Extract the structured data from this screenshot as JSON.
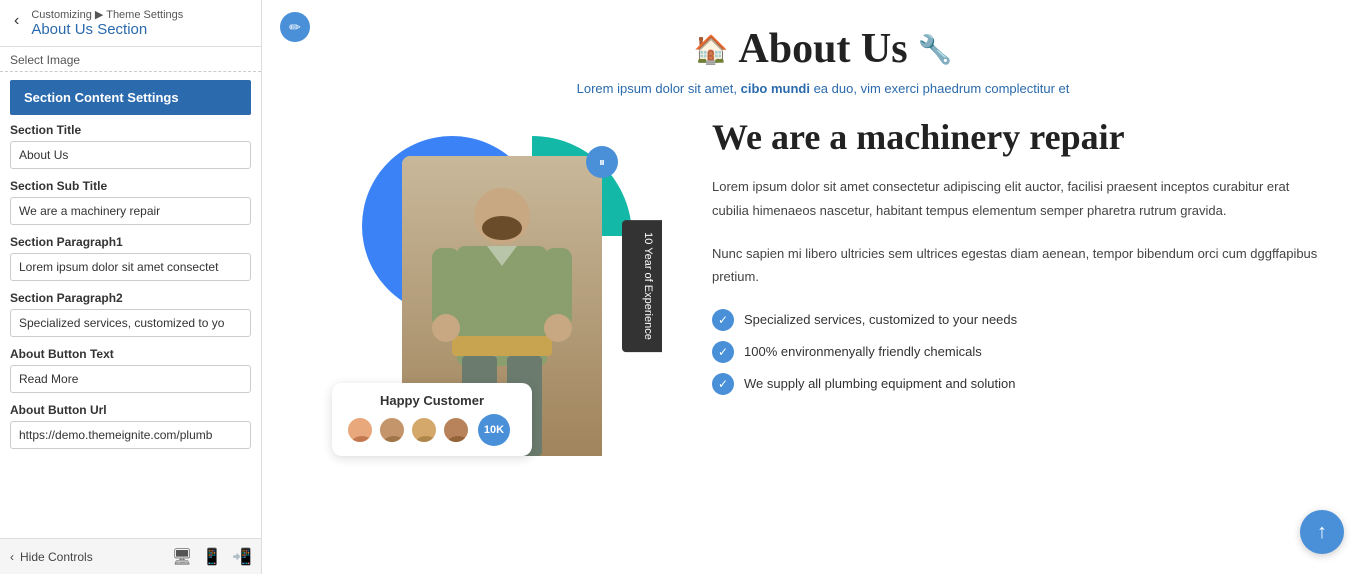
{
  "leftPanel": {
    "breadcrumb": "Customizing ▶ Theme Settings",
    "sectionHeader": "About Us Section",
    "selectImageLabel": "Select Image",
    "sectionContentBtn": "Section Content Settings",
    "fields": [
      {
        "label": "Section Title",
        "value": "About Us",
        "placeholder": "About Us"
      },
      {
        "label": "Section Sub Title",
        "value": "We are a machinery repair",
        "placeholder": "We are a machinery repair"
      },
      {
        "label": "Section Paragraph1",
        "value": "Lorem ipsum dolor sit amet consectet",
        "placeholder": "Lorem ipsum dolor sit amet..."
      },
      {
        "label": "Section Paragraph2",
        "value": "Specialized services, customized to yo",
        "placeholder": "Specialized services..."
      },
      {
        "label": "About Button Text",
        "value": "Read More",
        "placeholder": "Read More"
      },
      {
        "label": "About Button Url",
        "value": "https://demo.themeignite.com/plumb",
        "placeholder": "https://..."
      }
    ]
  },
  "bottomBar": {
    "hideControls": "Hide Controls"
  },
  "preview": {
    "mainTitle": "About Us",
    "subtitle": "Lorem ipsum dolor sit amet, cibo mundi ea duo, vim exerci phaedrum complectitur et",
    "sectionSubtitle": "We are a machinery repair",
    "paragraph1": "Lorem ipsum dolor sit amet consectetur adipiscing elit auctor, facilisi praesent inceptos curabitur erat cubilia himenaeos nascetur, habitant tempus elementum semper pharetra rutrum gravida.",
    "paragraph2": "Nunc sapien mi libero ultricies sem ultrices egestas diam aenean, tempor bibendum orci cum dggffapibus pretium.",
    "checklist": [
      "Specialized services, customized to your needs",
      "100% environmenyally friendly chemicals",
      "We supply all plumbing equipment and solution"
    ],
    "experienceBadge": "10 Year of Experience",
    "happyCustomer": "Happy Customer",
    "countBadge": "10K"
  }
}
